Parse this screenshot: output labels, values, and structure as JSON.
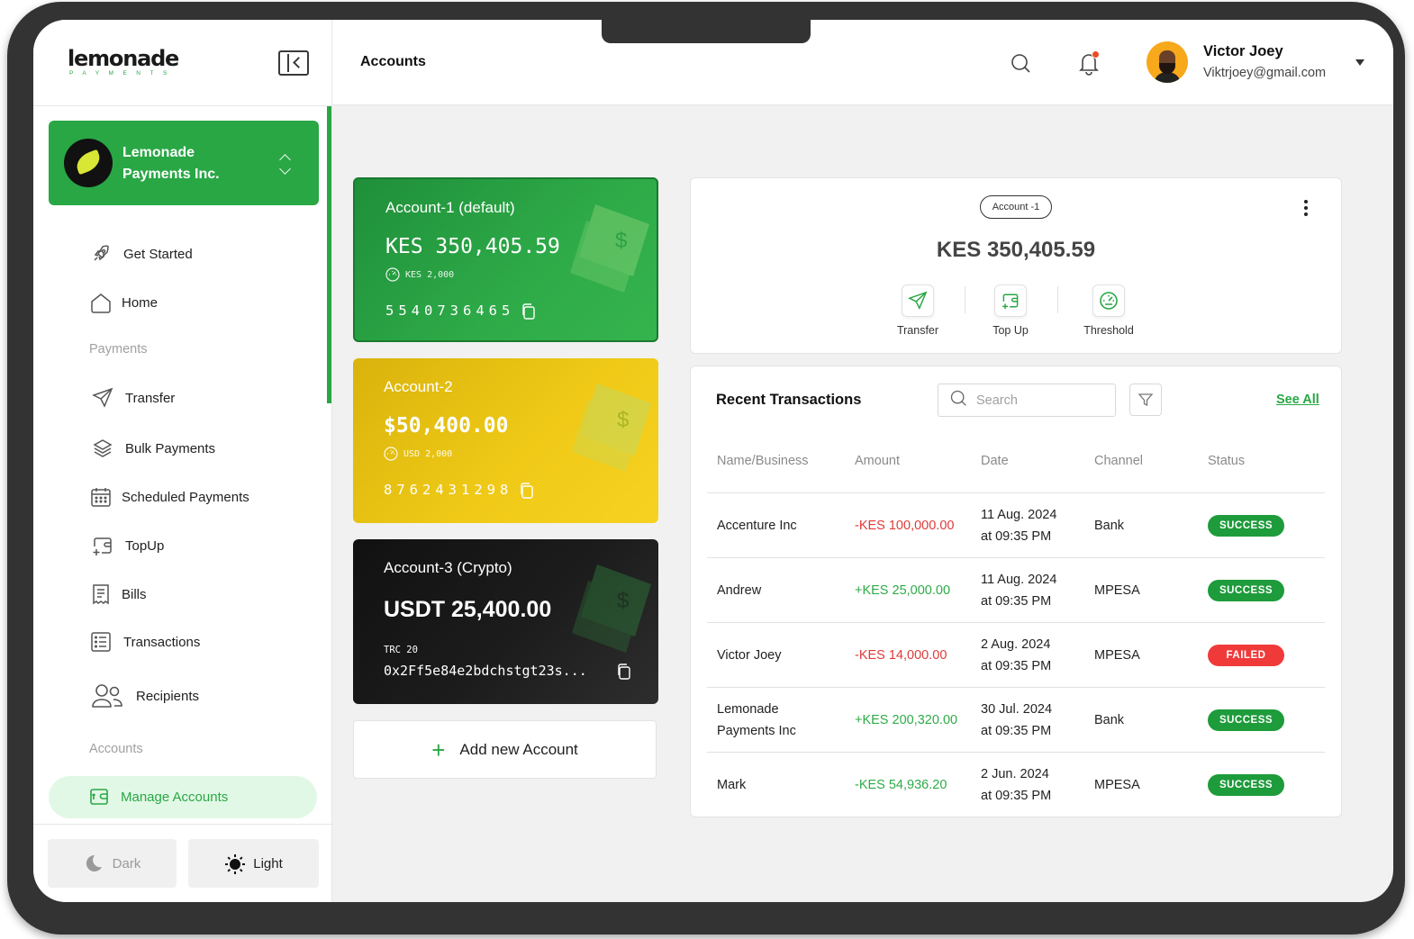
{
  "app": {
    "logo_word": "lemonade",
    "logo_sub": "PAYMENTS",
    "page_title": "Accounts"
  },
  "user": {
    "name": "Victor Joey",
    "email": "Viktrjoey@gmail.com"
  },
  "org": {
    "name": "Lemonade Payments Inc."
  },
  "sidebar": {
    "items": [
      {
        "label": "Get Started",
        "icon": "rocket-icon"
      },
      {
        "label": "Home",
        "icon": "home-icon"
      },
      {
        "label": "Transfer",
        "icon": "send-icon"
      },
      {
        "label": "Bulk Payments",
        "icon": "layers-icon"
      },
      {
        "label": "Scheduled Payments",
        "icon": "calendar-icon"
      },
      {
        "label": "TopUp",
        "icon": "wallet-add-icon"
      },
      {
        "label": "Bills",
        "icon": "receipt-icon"
      },
      {
        "label": "Transactions",
        "icon": "list-icon"
      },
      {
        "label": "Recipients",
        "icon": "users-icon"
      }
    ],
    "section_payments": "Payments",
    "section_accounts": "Accounts",
    "manage_accounts": "Manage Accounts",
    "theme_dark": "Dark",
    "theme_light": "Light"
  },
  "accounts": [
    {
      "name": "Account-1 (default)",
      "balance": "KES 350,405.59",
      "threshold": "KES 2,000",
      "number": "5540736465",
      "color": "#29a745"
    },
    {
      "name": "Account-2",
      "balance": "$50,400.00",
      "threshold": "USD 2,000",
      "number": "8762431298",
      "color": "#f2cb17"
    },
    {
      "name": "Account-3 (Crypto)",
      "balance": "USDT 25,400.00",
      "network": "TRC 20",
      "address": "0x2Ff5e84e2bdchstgt23s...",
      "color": "#151515"
    }
  ],
  "add_account_label": "Add new Account",
  "balance_panel": {
    "pill": "Account -1",
    "balance": "KES 350,405.59",
    "actions": [
      {
        "label": "Transfer",
        "icon": "send-icon"
      },
      {
        "label": "Top Up",
        "icon": "wallet-add-icon"
      },
      {
        "label": "Threshold",
        "icon": "gauge-icon"
      }
    ]
  },
  "transactions": {
    "title": "Recent Transactions",
    "search_placeholder": "Search",
    "see_all": "See All",
    "columns": [
      "Name/Business",
      "Amount",
      "Date",
      "Channel",
      "Status"
    ],
    "rows": [
      {
        "name": "Accenture Inc",
        "amount": "-KES 100,000.00",
        "sign": "neg",
        "date": "11 Aug. 2024",
        "time": "at 09:35 PM",
        "channel": "Bank",
        "status": "SUCCESS"
      },
      {
        "name": "Andrew",
        "amount": "+KES 25,000.00",
        "sign": "pos",
        "date": "11 Aug. 2024",
        "time": "at 09:35 PM",
        "channel": "MPESA",
        "status": "SUCCESS"
      },
      {
        "name": "Victor Joey",
        "amount": "-KES 14,000.00",
        "sign": "neg",
        "date": "2 Aug. 2024",
        "time": "at 09:35 PM",
        "channel": "MPESA",
        "status": "FAILED"
      },
      {
        "name": "Lemonade\nPayments Inc",
        "amount": "+KES 200,320.00",
        "sign": "pos",
        "date": "30 Jul. 2024",
        "time": "at 09:35 PM",
        "channel": "Bank",
        "status": "SUCCESS"
      },
      {
        "name": "Mark",
        "amount": "-KES 54,936.20",
        "sign": "pos",
        "date": "2 Jun. 2024",
        "time": "at 09:35 PM",
        "channel": "MPESA",
        "status": "SUCCESS"
      }
    ]
  },
  "colors": {
    "brand_green": "#29a745",
    "success": "#1e9b3b",
    "failed": "#f03a3a",
    "negative_amount": "#e03a3a",
    "positive_amount": "#2eab48"
  }
}
